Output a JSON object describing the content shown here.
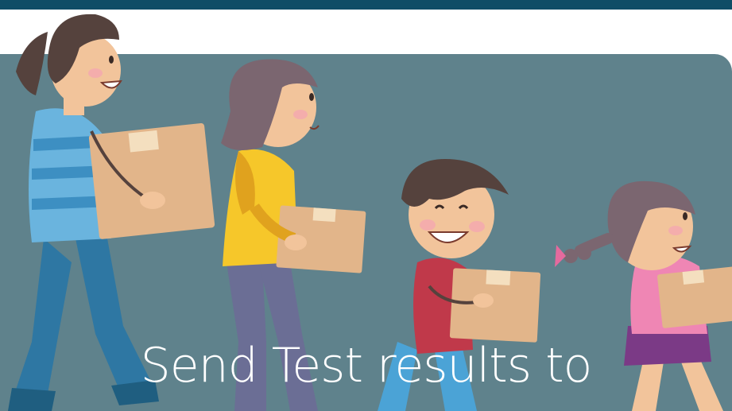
{
  "header": {
    "bar_color": "#0f4d66"
  },
  "hero": {
    "background_color": "#5f828c",
    "illustration": "family-carrying-moving-boxes",
    "headline": "Send Test results to"
  }
}
